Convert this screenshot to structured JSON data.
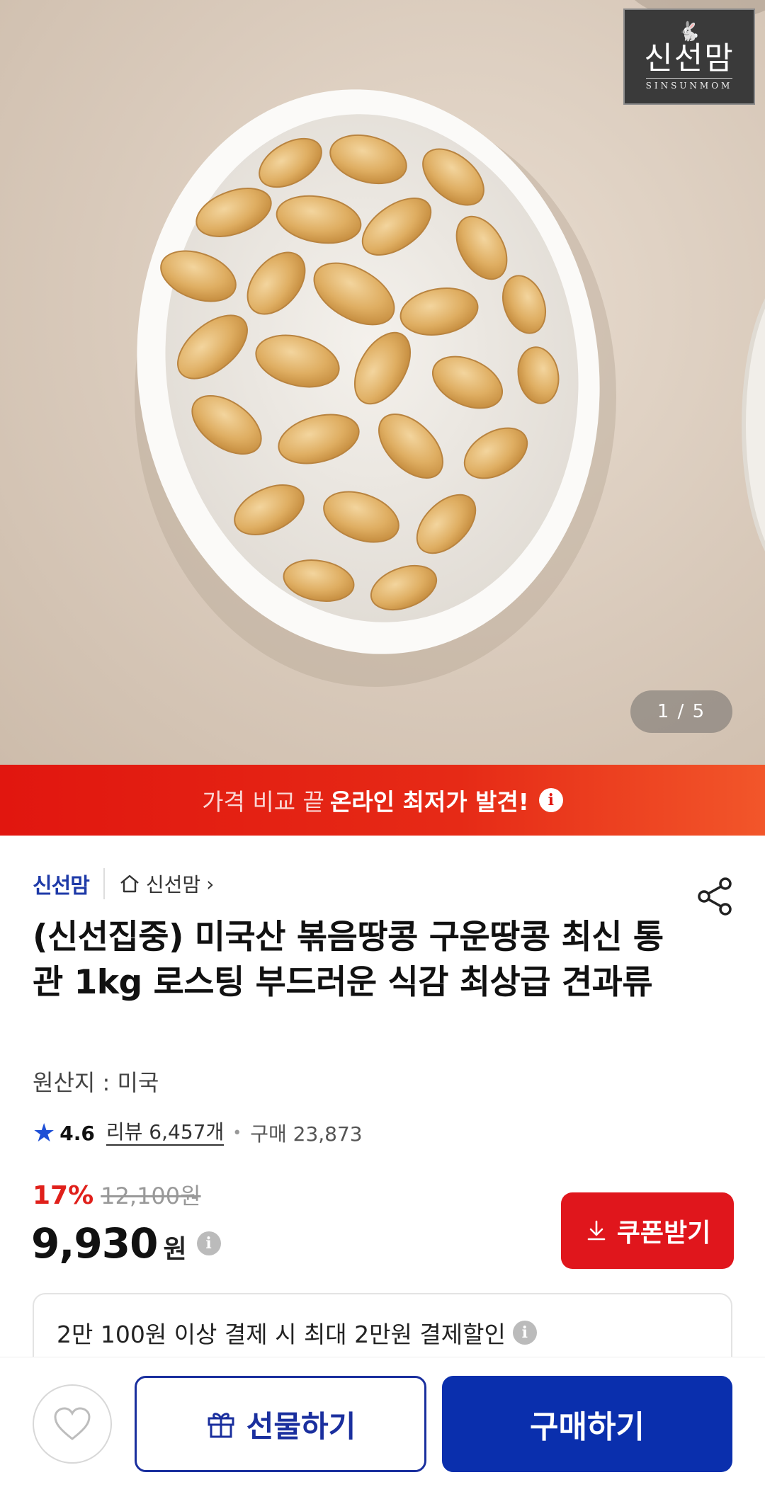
{
  "hero": {
    "logo_name": "신선맘",
    "logo_sub": "SINSUNMOM",
    "pager": "1 / 5"
  },
  "promo": {
    "light_text": "가격 비교 끝",
    "bold_text": "온라인 최저가 발견!",
    "info_icon": "info-icon"
  },
  "store": {
    "logo_text": "신선맘",
    "link_label": "신선맘",
    "home_icon": "home-icon",
    "chevron": "›"
  },
  "product": {
    "title": "(신선집중) 미국산 볶음땅콩 구운땅콩 최신 통관 1kg 로스팅 부드러운 식감 최상급 견과류",
    "origin": "원산지 : 미국",
    "rating": "4.6",
    "review_label": "리뷰 6,457개",
    "purchase_label": "구매 23,873",
    "discount_rate": "17%",
    "original_price": "12,100원",
    "price": "9,930",
    "currency": "원"
  },
  "coupon": {
    "label": "쿠폰받기"
  },
  "payment": {
    "text": "2만 100원 이상 결제 시 최대 2만원 결제할인"
  },
  "bottom": {
    "gift_label": "선물하기",
    "buy_label": "구매하기"
  },
  "colors": {
    "accent_red": "#e0161c",
    "brand_blue": "#0a2fad",
    "rating_star": "#1e4fd6"
  }
}
